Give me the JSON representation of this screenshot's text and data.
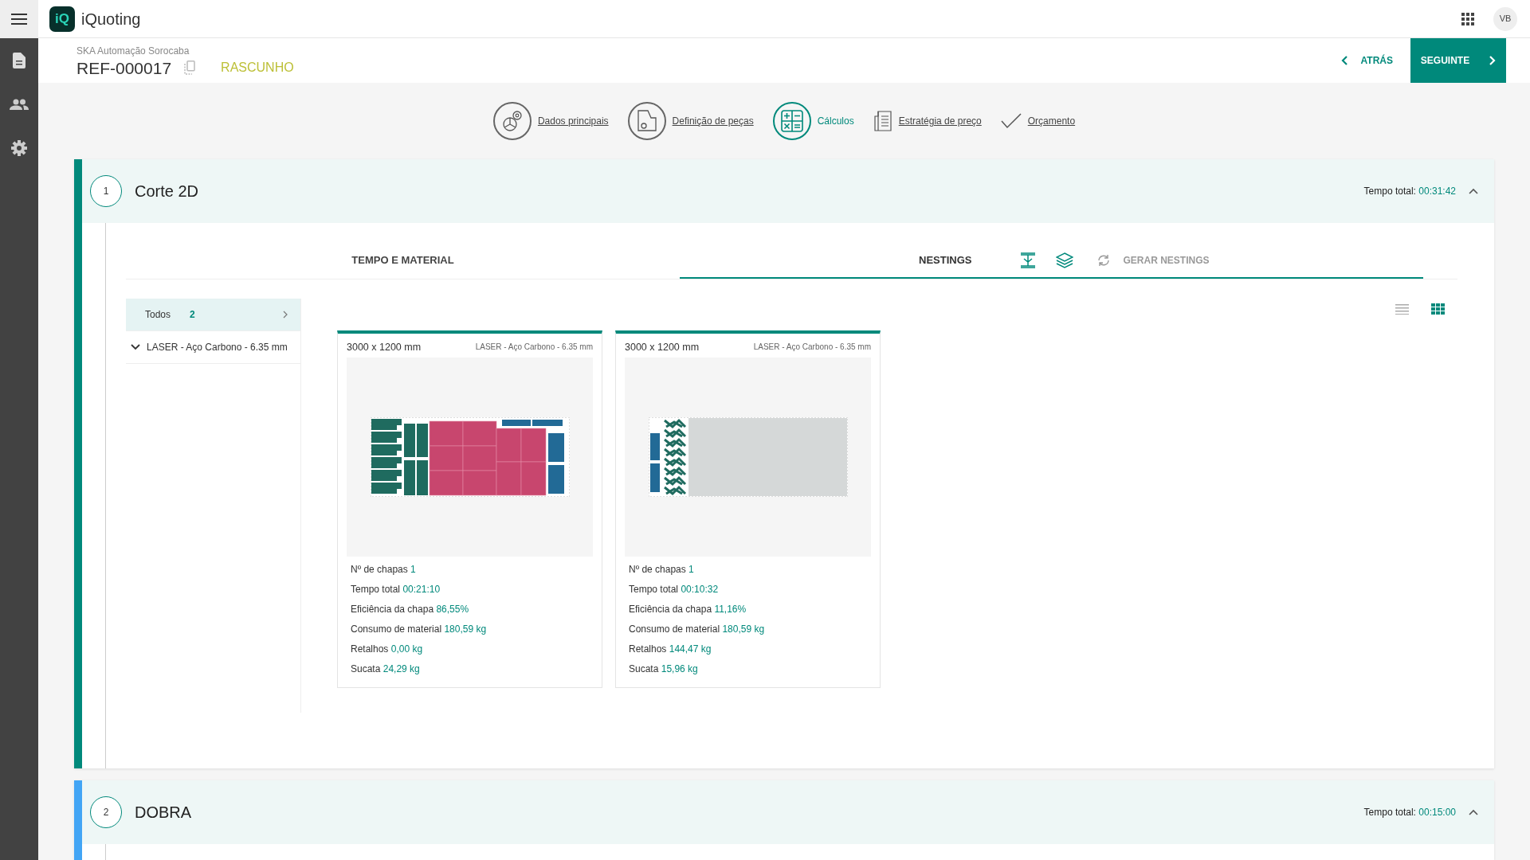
{
  "app": {
    "logo": "iQ",
    "title": "iQuoting",
    "avatar": "VB"
  },
  "header": {
    "company": "SKA Automação Sorocaba",
    "reference": "REF-000017",
    "status": "RASCUNHO",
    "back": "ATRÁS",
    "next": "SEGUINTE"
  },
  "steps": [
    {
      "label": "Dados principais",
      "selected": false
    },
    {
      "label": "Definição de peças",
      "selected": false
    },
    {
      "label": "Cálculos",
      "selected": true
    },
    {
      "label": "Estratégia de preço",
      "selected": false
    },
    {
      "label": "Orçamento",
      "selected": false
    }
  ],
  "sections": [
    {
      "number": "1",
      "title": "Corte 2D",
      "total_label": "Tempo total:",
      "total": "00:31:42",
      "color": "#00897b",
      "tabs": [
        {
          "label": "TEMPO E MATERIAL",
          "selected": false
        },
        {
          "label": "NESTINGS",
          "selected": true
        }
      ],
      "action": {
        "label": "GERAR NESTINGS",
        "disabled": true
      },
      "filters": [
        {
          "kind": "all",
          "label": "Todos",
          "count": "2",
          "selected": true
        },
        {
          "kind": "group",
          "label": "LASER - Aço Carbono - 6.35 mm",
          "selected": false
        }
      ],
      "view_modes": [
        {
          "kind": "list",
          "selected": false
        },
        {
          "kind": "grid",
          "selected": true
        }
      ],
      "nestings": [
        {
          "kind": "full",
          "size": "3000 x 1200 mm",
          "material": "LASER - Aço Carbono - 6.35 mm",
          "stats": [
            {
              "label": "Nº de chapas",
              "value": "1"
            },
            {
              "label": "Tempo total",
              "value": "00:21:10"
            },
            {
              "label": "Eficiência da chapa",
              "value": "86,55%"
            },
            {
              "label": "Consumo de material",
              "value": "180,59 kg"
            },
            {
              "label": "Retalhos",
              "value": "0,00 kg"
            },
            {
              "label": "Sucata",
              "value": "24,29 kg"
            }
          ]
        },
        {
          "kind": "partial",
          "size": "3000 x 1200 mm",
          "material": "LASER - Aço Carbono - 6.35 mm",
          "stats": [
            {
              "label": "Nº de chapas",
              "value": "1"
            },
            {
              "label": "Tempo total",
              "value": "00:10:32"
            },
            {
              "label": "Eficiência da chapa",
              "value": "11,16%"
            },
            {
              "label": "Consumo de material",
              "value": "180,59 kg"
            },
            {
              "label": "Retalhos",
              "value": "144,47 kg"
            },
            {
              "label": "Sucata",
              "value": "15,96 kg"
            }
          ]
        }
      ]
    },
    {
      "number": "2",
      "title": "DOBRA",
      "total_label": "Tempo total:",
      "total": "00:15:00",
      "color": "#42a5f5"
    }
  ]
}
